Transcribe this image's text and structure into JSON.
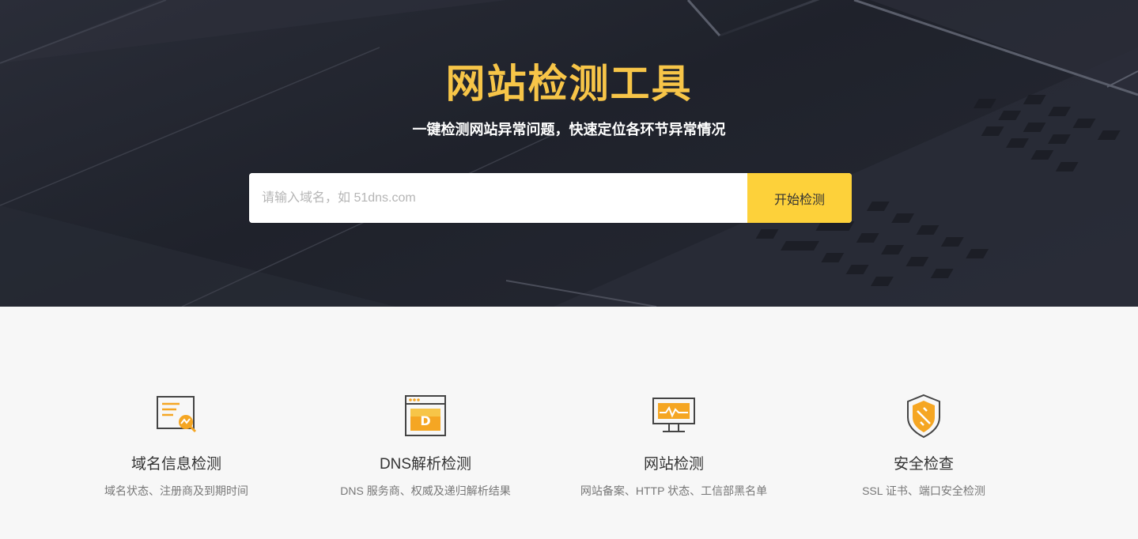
{
  "hero": {
    "title": "网站检测工具",
    "subtitle": "一键检测网站异常问题，快速定位各环节异常情况"
  },
  "search": {
    "placeholder": "请输入域名，如 51dns.com",
    "value": "",
    "button_label": "开始检测"
  },
  "features": [
    {
      "icon": "domain-report-icon",
      "title": "域名信息检测",
      "desc": "域名状态、注册商及到期时间"
    },
    {
      "icon": "dns-browser-icon",
      "title": "DNS解析检测",
      "desc": "DNS 服务商、权威及递归解析结果"
    },
    {
      "icon": "monitor-icon",
      "title": "网站检测",
      "desc": "网站备案、HTTP 状态、工信部黑名单"
    },
    {
      "icon": "shield-icon",
      "title": "安全检查",
      "desc": "SSL 证书、端口安全检测"
    }
  ],
  "colors": {
    "accent": "#fdd13a",
    "title": "#f7c548",
    "hero_bg": "#23262f",
    "icon_orange": "#f5a623"
  }
}
